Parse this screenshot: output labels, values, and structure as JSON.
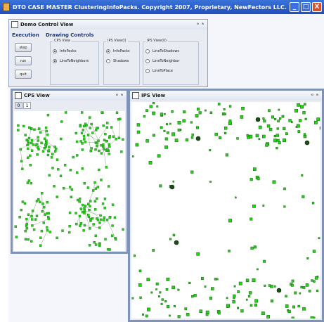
{
  "app": {
    "title": "DTO CASE MASTER ClusteringInfoPacks. Copyright 2007, Proprietary, NewFectors LLC. All Rights Reserved.",
    "icon": "app-icon",
    "buttons": {
      "minimize": "_",
      "maximize": "□",
      "close": "X"
    }
  },
  "demo_control": {
    "title": "Demo Control View",
    "frame_controls": "ᴼ ᴿ",
    "execution": {
      "label": "Execution",
      "buttons": [
        "step",
        "run",
        "quit"
      ]
    },
    "drawing": {
      "label": "Drawing Controls",
      "groups": [
        {
          "title": "CPS View",
          "options": [
            "InfoPacks",
            "LineToNeighbors"
          ],
          "selected": [
            true,
            true
          ]
        },
        {
          "title": "IPS View(I)",
          "options": [
            "InfoPacks",
            "Shadows"
          ],
          "selected": [
            true,
            false
          ]
        },
        {
          "title": "IPS View(II)",
          "options": [
            "LineToShadows",
            "LineToNeighbor",
            "LineToPlace"
          ],
          "selected": [
            false,
            false,
            false
          ]
        }
      ]
    }
  },
  "cps_view": {
    "title": "CPS View",
    "frame_controls": "ᴼ ᴿ",
    "tabs": [
      "0",
      "1"
    ]
  },
  "ips_view": {
    "title": "IPS View",
    "frame_controls": "ᴼ ᴿ"
  },
  "colors": {
    "infopack_fill": "#22d614",
    "infopack_edge": "#1f6b1a",
    "link": "#3a6a2e",
    "titlebar": "#2a5dd0"
  }
}
